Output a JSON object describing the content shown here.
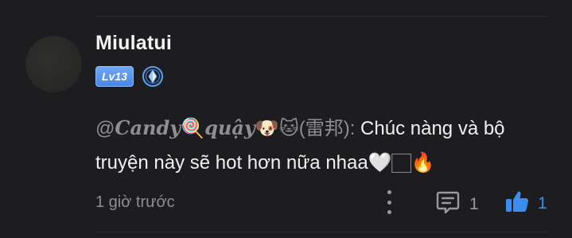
{
  "comment": {
    "username": "Miulatui",
    "level": "Lv13",
    "mention_at": "@",
    "mention_name": "Candy",
    "mention_lollipop": "🍭",
    "mention_name2": "quậy",
    "mention_emojis": "🐶🐱",
    "mention_tag": "(雷邦):",
    "text_line1": " Chúc nàng và bộ",
    "text_line2": "truyện này sẽ hot hơn nữa nhaa",
    "text_end": "🤍🏻🔥",
    "time": "1 giờ trước",
    "reply_count": "1",
    "like_count": "1"
  },
  "colors": {
    "accent": "#3b8df0",
    "level_badge": "#4a86e8",
    "muted": "#8e8e93"
  },
  "icons": {
    "more": "more-vertical-icon",
    "reply": "comment-icon",
    "like": "thumbs-up-icon",
    "rank": "diamond-rank-icon"
  }
}
